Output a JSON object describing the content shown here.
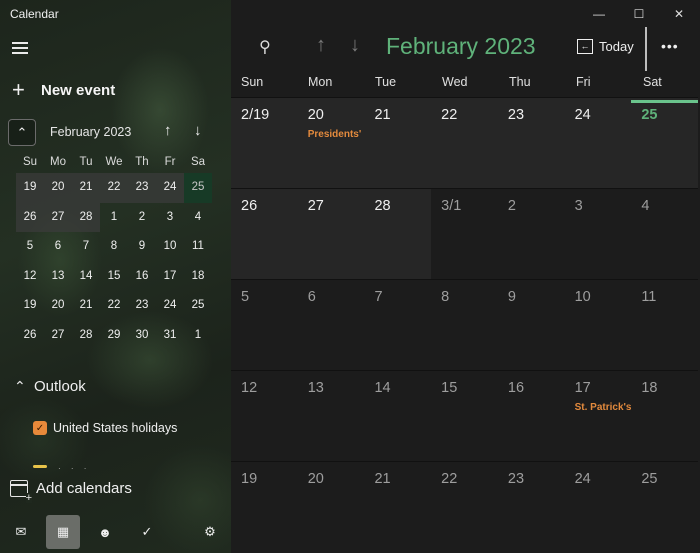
{
  "app": {
    "title": "Calendar"
  },
  "sidebar": {
    "new_event_label": "New event",
    "mini_calendar": {
      "month_label": "February 2023",
      "days_of_week": [
        "Su",
        "Mo",
        "Tu",
        "We",
        "Th",
        "Fr",
        "Sa"
      ],
      "weeks": [
        [
          "19",
          "20",
          "21",
          "22",
          "23",
          "24",
          "25"
        ],
        [
          "26",
          "27",
          "28",
          "1",
          "2",
          "3",
          "4"
        ],
        [
          "5",
          "6",
          "7",
          "8",
          "9",
          "10",
          "11"
        ],
        [
          "12",
          "13",
          "14",
          "15",
          "16",
          "17",
          "18"
        ],
        [
          "19",
          "20",
          "21",
          "22",
          "23",
          "24",
          "25"
        ],
        [
          "26",
          "27",
          "28",
          "29",
          "30",
          "31",
          "1"
        ]
      ]
    },
    "outlook_label": "Outlook",
    "calendars": [
      {
        "label": "United States holidays",
        "checked": true,
        "color": "#e8893a"
      },
      {
        "label": "· · ·",
        "checked": false,
        "color": "#e8c34a"
      }
    ],
    "add_calendars_label": "Add calendars",
    "bottom_nav": [
      "mail",
      "calendar",
      "people",
      "to-do",
      "settings"
    ]
  },
  "main": {
    "window_controls": {
      "minimize": "—",
      "maximize": "☐",
      "close": "✕"
    },
    "month_title": "February 2023",
    "today_label": "Today",
    "more_label": "•••",
    "days_of_week": [
      "Sun",
      "Mon",
      "Tue",
      "Wed",
      "Thu",
      "Fri",
      "Sat"
    ],
    "weeks": [
      [
        {
          "n": "2/19"
        },
        {
          "n": "20",
          "event": "Presidents' Day"
        },
        {
          "n": "21"
        },
        {
          "n": "22"
        },
        {
          "n": "23"
        },
        {
          "n": "24"
        },
        {
          "n": "25",
          "today": true
        }
      ],
      [
        {
          "n": "26"
        },
        {
          "n": "27"
        },
        {
          "n": "28"
        },
        {
          "n": "3/1",
          "other": true
        },
        {
          "n": "2",
          "other": true
        },
        {
          "n": "3",
          "other": true
        },
        {
          "n": "4",
          "other": true
        }
      ],
      [
        {
          "n": "5",
          "other": true
        },
        {
          "n": "6",
          "other": true
        },
        {
          "n": "7",
          "other": true
        },
        {
          "n": "8",
          "other": true
        },
        {
          "n": "9",
          "other": true
        },
        {
          "n": "10",
          "other": true
        },
        {
          "n": "11",
          "other": true
        }
      ],
      [
        {
          "n": "12",
          "other": true
        },
        {
          "n": "13",
          "other": true
        },
        {
          "n": "14",
          "other": true
        },
        {
          "n": "15",
          "other": true
        },
        {
          "n": "16",
          "other": true
        },
        {
          "n": "17",
          "other": true,
          "event": "St. Patrick's Day"
        },
        {
          "n": "18",
          "other": true
        }
      ],
      [
        {
          "n": "19",
          "other": true
        },
        {
          "n": "20",
          "other": true
        },
        {
          "n": "21",
          "other": true
        },
        {
          "n": "22",
          "other": true
        },
        {
          "n": "23",
          "other": true
        },
        {
          "n": "24",
          "other": true
        },
        {
          "n": "25",
          "other": true
        }
      ]
    ],
    "accent_color": "#5fb27a",
    "event_color": "#e38a3d"
  }
}
